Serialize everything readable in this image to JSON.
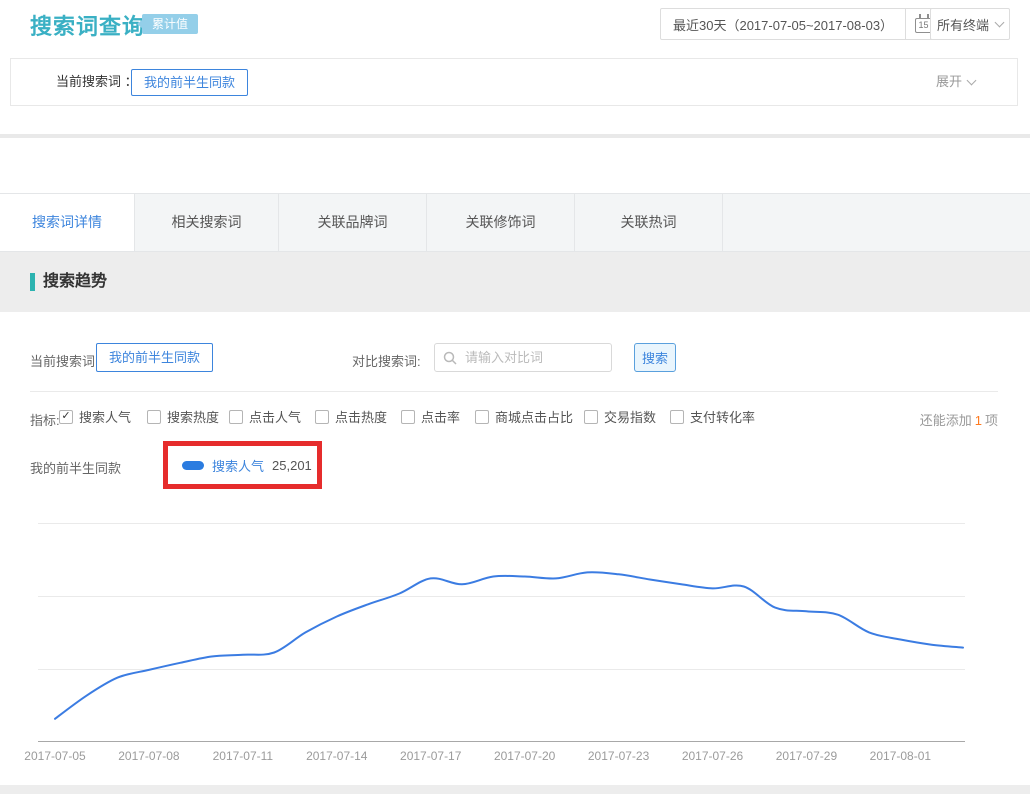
{
  "header": {
    "title": "搜索词查询",
    "badge": "累计值",
    "date_range": "最近30天（2017-07-05~2017-08-03）",
    "calendar_day": "15",
    "terminal_selector": "所有终端"
  },
  "current_search_bar": {
    "label": "当前搜索词 ：",
    "keyword": "我的前半生同款",
    "expand": "展开"
  },
  "tabs": [
    {
      "label": "搜索词详情",
      "active": true
    },
    {
      "label": "相关搜索词",
      "active": false
    },
    {
      "label": "关联品牌词",
      "active": false
    },
    {
      "label": "关联修饰词",
      "active": false
    },
    {
      "label": "关联热词",
      "active": false
    }
  ],
  "section": {
    "title": "搜索趋势"
  },
  "trend_controls": {
    "current_label": "当前搜索词:",
    "current_keyword": "我的前半生同款",
    "compare_label": "对比搜索词:",
    "compare_placeholder": "请输入对比词",
    "search_button": "搜索"
  },
  "metrics": {
    "label": "指标:",
    "options": [
      {
        "label": "搜索人气",
        "checked": true
      },
      {
        "label": "搜索热度",
        "checked": false
      },
      {
        "label": "点击人气",
        "checked": false
      },
      {
        "label": "点击热度",
        "checked": false
      },
      {
        "label": "点击率",
        "checked": false
      },
      {
        "label": "商城点击占比",
        "checked": false
      },
      {
        "label": "交易指数",
        "checked": false
      },
      {
        "label": "支付转化率",
        "checked": false
      }
    ],
    "remaining_prefix": "还能添加",
    "remaining_count": "1",
    "remaining_suffix": "项"
  },
  "legend": {
    "keyword": "我的前半生同款",
    "metric": "搜索人气",
    "value": "25,201"
  },
  "colors": {
    "accent_teal": "#3ab0c4",
    "accent_blue": "#3d85dd",
    "line_blue": "#3b7ce2",
    "annotation_red": "#e62c2c",
    "orange": "#ff7a1f"
  },
  "chart_data": {
    "type": "line",
    "title": "搜索趋势",
    "x": [
      "2017-07-05",
      "2017-07-06",
      "2017-07-07",
      "2017-07-08",
      "2017-07-09",
      "2017-07-10",
      "2017-07-11",
      "2017-07-12",
      "2017-07-13",
      "2017-07-14",
      "2017-07-15",
      "2017-07-16",
      "2017-07-17",
      "2017-07-18",
      "2017-07-19",
      "2017-07-20",
      "2017-07-21",
      "2017-07-22",
      "2017-07-23",
      "2017-07-24",
      "2017-07-25",
      "2017-07-26",
      "2017-07-27",
      "2017-07-28",
      "2017-07-29",
      "2017-07-30",
      "2017-07-31",
      "2017-08-01",
      "2017-08-02",
      "2017-08-03"
    ],
    "x_tick_labels": [
      "2017-07-05",
      "2017-07-08",
      "2017-07-11",
      "2017-07-14",
      "2017-07-17",
      "2017-07-20",
      "2017-07-23",
      "2017-07-26",
      "2017-07-29",
      "2017-08-01"
    ],
    "series": [
      {
        "name": "搜索人气",
        "values": [
          6000,
          12200,
          17100,
          19200,
          21100,
          22800,
          23300,
          23900,
          29300,
          33600,
          36900,
          39800,
          43900,
          42300,
          44400,
          44400,
          43900,
          45500,
          45000,
          43600,
          42300,
          41200,
          41700,
          36000,
          35000,
          34100,
          29300,
          27400,
          26000,
          25201
        ]
      }
    ],
    "ylim": [
      0,
      61000
    ],
    "grid": true,
    "legend_position": "above-left",
    "line_color": "#3b7ce2",
    "note": "y-axis unlabeled; values estimated from gridlines, last point anchored to highlighted value 25,201"
  }
}
